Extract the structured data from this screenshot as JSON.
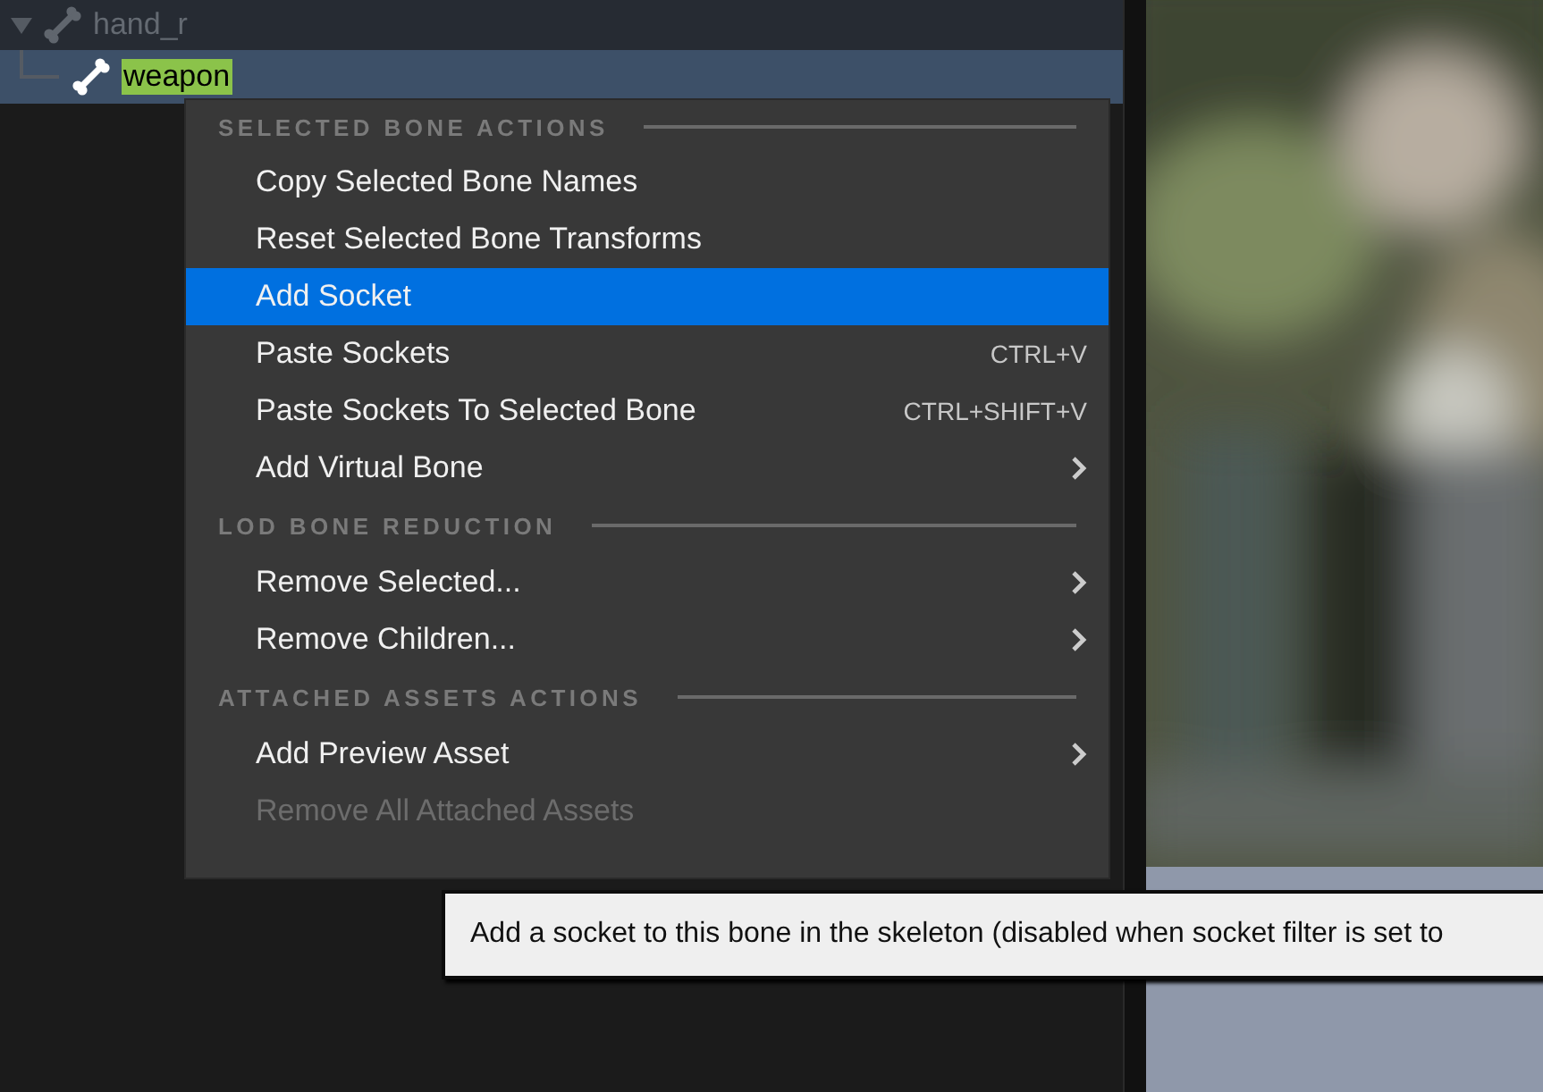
{
  "tree": [
    {
      "label": "hand_r",
      "selected": false,
      "highlight": false
    },
    {
      "label": "weapon",
      "selected": true,
      "highlight": true
    }
  ],
  "context_menu": {
    "sections": [
      {
        "heading": "SELECTED BONE ACTIONS",
        "items": [
          {
            "label": "Copy Selected Bone Names",
            "selected": false,
            "disabled": false,
            "submenu": false
          },
          {
            "label": "Reset Selected Bone Transforms",
            "selected": false,
            "disabled": false,
            "submenu": false
          },
          {
            "label": "Add Socket",
            "selected": true,
            "disabled": false,
            "submenu": false
          },
          {
            "label": "Paste Sockets",
            "shortcut": "CTRL+V",
            "selected": false,
            "disabled": false,
            "submenu": false
          },
          {
            "label": "Paste Sockets To Selected Bone",
            "shortcut": "CTRL+SHIFT+V",
            "selected": false,
            "disabled": false,
            "submenu": false
          },
          {
            "label": "Add Virtual Bone",
            "selected": false,
            "disabled": false,
            "submenu": true
          }
        ]
      },
      {
        "heading": "LOD BONE REDUCTION",
        "items": [
          {
            "label": "Remove Selected...",
            "selected": false,
            "disabled": false,
            "submenu": true
          },
          {
            "label": "Remove Children...",
            "selected": false,
            "disabled": false,
            "submenu": true
          }
        ]
      },
      {
        "heading": "ATTACHED ASSETS ACTIONS",
        "items": [
          {
            "label": "Add Preview Asset",
            "selected": false,
            "disabled": false,
            "submenu": true
          },
          {
            "label": "Remove All Attached Assets",
            "selected": false,
            "disabled": true,
            "submenu": false
          }
        ]
      }
    ]
  },
  "tooltip": "Add a socket to this bone in the skeleton (disabled when socket filter is set to"
}
